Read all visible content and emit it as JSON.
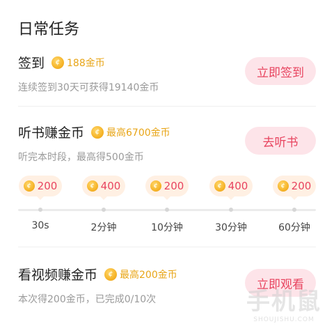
{
  "section_title": "日常任务",
  "coin_icon": "coin-icon",
  "colors": {
    "accent": "#e8445f",
    "gold": "#e8a517",
    "pill_bg": "#fde4e9",
    "bubble_bg": "#fff0e3"
  },
  "tasks": [
    {
      "name": "签到",
      "reward": "188金币",
      "desc": "连续签到30天可获得19140金币",
      "button": "立即签到"
    },
    {
      "name": "听书赚金币",
      "reward": "最高6700金币",
      "desc": "听完本时段，最高得500金币",
      "button": "去听书"
    },
    {
      "name": "看视频赚金币",
      "reward": "最高200金币",
      "desc": "本次得200金币，已完成0/10次",
      "button": "立即观看"
    }
  ],
  "milestones": [
    {
      "value": "200",
      "label": "30s"
    },
    {
      "value": "400",
      "label": "2分钟"
    },
    {
      "value": "200",
      "label": "10分钟"
    },
    {
      "value": "400",
      "label": "30分钟"
    },
    {
      "value": "200",
      "label": "60分钟"
    }
  ],
  "watermark": {
    "main": "手机鼠",
    "sub": "SHOUJISHU.COM"
  }
}
